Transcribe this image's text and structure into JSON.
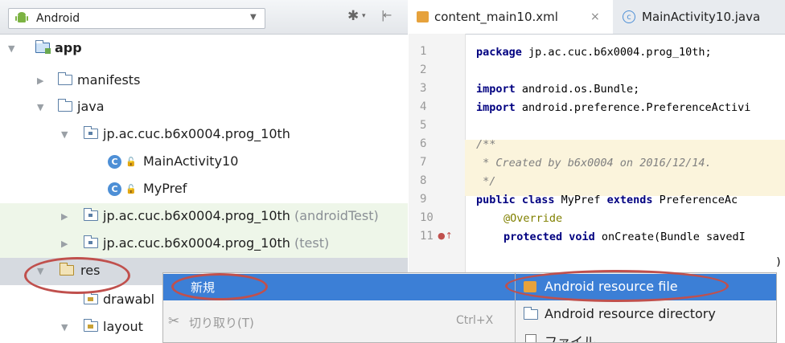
{
  "project_panel": {
    "view_selector": "Android",
    "tree": [
      {
        "label": "app",
        "bold": true
      },
      {
        "label": "manifests"
      },
      {
        "label": "java"
      },
      {
        "label": "jp.ac.cuc.b6x0004.prog_10th"
      },
      {
        "label": "MainActivity10"
      },
      {
        "label": "MyPref"
      },
      {
        "label": "jp.ac.cuc.b6x0004.prog_10th",
        "suffix": "(androidTest)"
      },
      {
        "label": "jp.ac.cuc.b6x0004.prog_10th",
        "suffix": "(test)"
      },
      {
        "label": "res"
      },
      {
        "label": "drawabl"
      },
      {
        "label": "layout"
      }
    ]
  },
  "editor": {
    "tabs": [
      {
        "label": "content_main10.xml",
        "close": "×"
      },
      {
        "label": "MainActivity10.java"
      }
    ],
    "line_numbers": [
      "1",
      "2",
      "3",
      "4",
      "5",
      "6",
      "7",
      "8",
      "9",
      "10",
      "11"
    ],
    "code": {
      "l1_kw": "package",
      "l1_rest": " jp.ac.cuc.b6x0004.prog_10th;",
      "l3_kw": "import",
      "l3_rest": " android.os.Bundle;",
      "l4_kw": "import",
      "l4_rest": " android.preference.PreferenceActivi",
      "l6": "/**",
      "l7": " * Created by b6x0004 on 2016/12/14.",
      "l8": " */",
      "l9_kw1": "public class",
      "l9_mid": " MyPref ",
      "l9_kw2": "extends",
      "l9_rest": " PreferenceAc",
      "l10": "@Override",
      "l11_kw": "protected void",
      "l11_rest": " onCreate(Bundle savedI",
      "l12_tail": ")"
    }
  },
  "context_menu": {
    "items": [
      {
        "label": "新規",
        "selected": true
      },
      {
        "label": "切り取り(T)",
        "shortcut": "Ctrl+X",
        "disabled": true
      }
    ]
  },
  "submenu": {
    "items": [
      {
        "label": "Android resource file",
        "selected": true
      },
      {
        "label": "Android resource directory"
      },
      {
        "label": "ファイル"
      }
    ]
  },
  "colors": {
    "selection": "#3c7fd6",
    "annotation_oval": "#c0504d",
    "green_row": "#eef6e9"
  }
}
